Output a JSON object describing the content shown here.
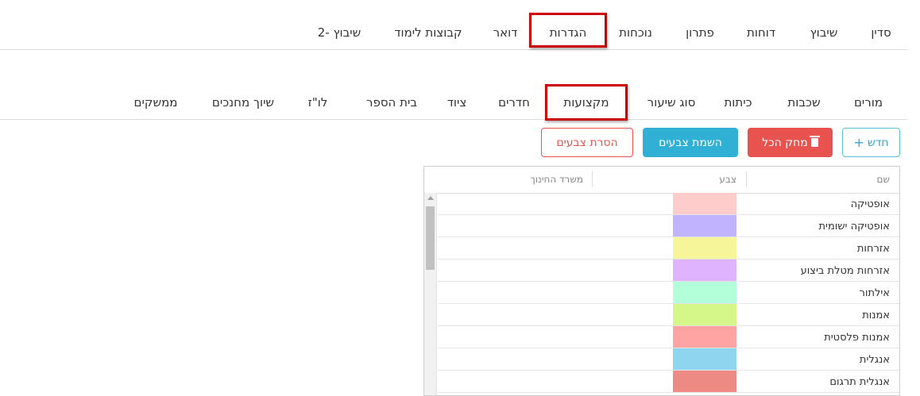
{
  "top_nav": {
    "items": [
      {
        "label": "סדין"
      },
      {
        "label": "שיבוץ"
      },
      {
        "label": "דוחות"
      },
      {
        "label": "פתרון"
      },
      {
        "label": "נוכחות"
      },
      {
        "label": "הגדרות"
      },
      {
        "label": "דואר"
      },
      {
        "label": "קבוצות לימוד"
      },
      {
        "label": "שיבוץ -2"
      }
    ],
    "highlighted": "הגדרות"
  },
  "sub_nav": {
    "items": [
      {
        "label": "מורים"
      },
      {
        "label": "שכבות"
      },
      {
        "label": "כיתות"
      },
      {
        "label": "סוג שיעור"
      },
      {
        "label": "מקצועות"
      },
      {
        "label": "חדרים"
      },
      {
        "label": "ציוד"
      },
      {
        "label": "בית הספר"
      },
      {
        "label": "לו\"ז"
      },
      {
        "label": "שיוך מחנכים"
      },
      {
        "label": "ממשקים"
      }
    ],
    "highlighted": "מקצועות"
  },
  "toolbar": {
    "new_label": "חדש",
    "new_icon": "plus-icon",
    "delete_all_label": "מחק הכל",
    "delete_icon": "trash-icon",
    "apply_colors_label": "השמת צבעים",
    "remove_colors_label": "הסרת צבעים"
  },
  "grid": {
    "columns": [
      "שם",
      "צבע",
      "משרד החינוך"
    ],
    "rows": [
      {
        "name": "אופטיקה",
        "color": "#ffcccc"
      },
      {
        "name": "אופטיקה ישומית",
        "color": "#c2b3ff"
      },
      {
        "name": "אזרחות",
        "color": "#f7f599"
      },
      {
        "name": "אזרחות מטלת ביצוע",
        "color": "#e0b3ff"
      },
      {
        "name": "אילתור",
        "color": "#b3ffd9"
      },
      {
        "name": "אמנות",
        "color": "#d5f78a"
      },
      {
        "name": "אמנות פלסטית",
        "color": "#ffa3a3"
      },
      {
        "name": "אנגלית",
        "color": "#8fd5f0"
      },
      {
        "name": "אנגלית תרגום",
        "color": "#ee8a84"
      }
    ]
  },
  "colors": {
    "highlight_border": "#cc0000",
    "btn_info": "#31b0d5",
    "btn_danger": "#e9534f"
  }
}
